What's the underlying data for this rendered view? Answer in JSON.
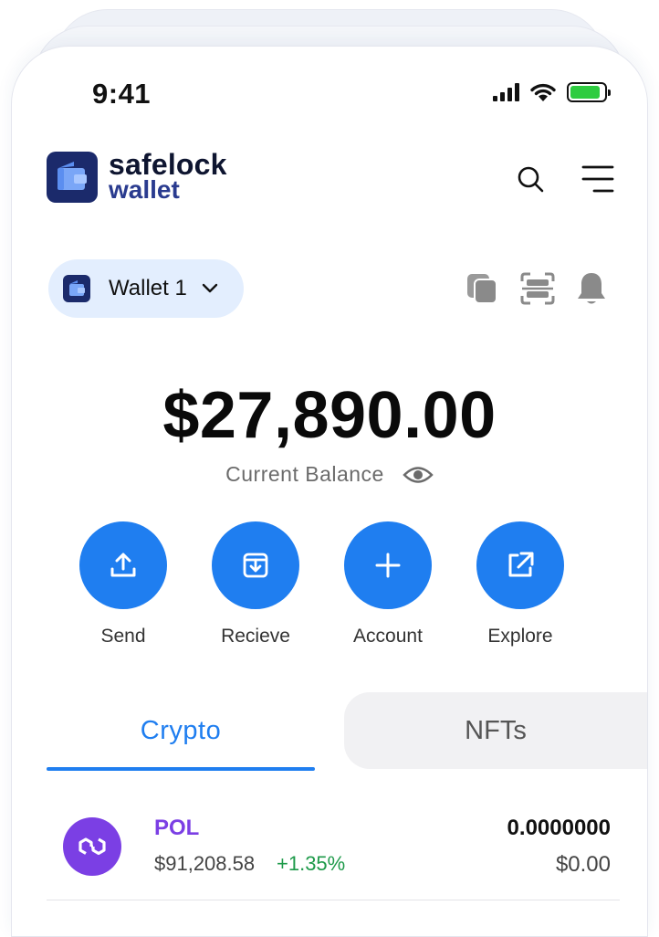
{
  "status": {
    "time": "9:41"
  },
  "brand": {
    "line1": "safelock",
    "line2": "wallet"
  },
  "wallet": {
    "name": "Wallet 1"
  },
  "balance": {
    "amount": "$27,890.00",
    "label": "Current Balance"
  },
  "actions": [
    {
      "label": "Send",
      "icon": "upload-icon"
    },
    {
      "label": "Recieve",
      "icon": "download-icon"
    },
    {
      "label": "Account",
      "icon": "plus-icon"
    },
    {
      "label": "Explore",
      "icon": "external-link-icon"
    }
  ],
  "tabs": [
    {
      "label": "Crypto",
      "active": true
    },
    {
      "label": "NFTs",
      "active": false
    }
  ],
  "tokens": [
    {
      "symbol": "POL",
      "price": "$91,208.58",
      "change": "+1.35%",
      "amount": "0.0000000",
      "fiat": "$0.00"
    }
  ],
  "colors": {
    "accent": "#1f7ef0",
    "brand": "#1b2a6b",
    "token": "#7b3fe4",
    "positive": "#1e9a4a",
    "pill": "#e3eefe"
  }
}
